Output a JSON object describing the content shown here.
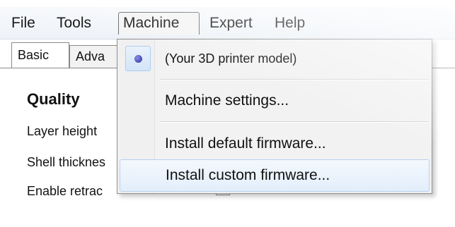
{
  "menubar": {
    "items": [
      {
        "label": "File"
      },
      {
        "label": "Tools"
      },
      {
        "label": "Machine"
      },
      {
        "label": "Expert"
      },
      {
        "label": "Help"
      }
    ]
  },
  "tabs": [
    {
      "label": "Basic"
    },
    {
      "label": "Adva"
    }
  ],
  "panel": {
    "section_title": "Quality",
    "settings": [
      {
        "label": "Layer height"
      },
      {
        "label": "Shell thicknes"
      },
      {
        "label": "Enable retrac"
      }
    ]
  },
  "machine_menu": {
    "items": [
      {
        "label": "(Your 3D printer model)"
      },
      {
        "label": "Machine settings..."
      },
      {
        "label": "Install default firmware..."
      },
      {
        "label": "Install custom firmware..."
      }
    ]
  }
}
